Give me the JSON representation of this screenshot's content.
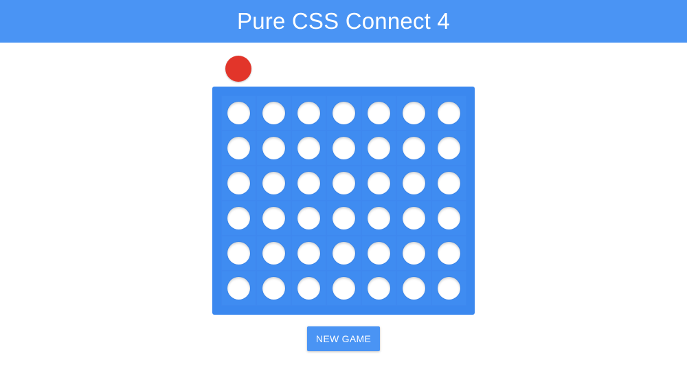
{
  "header": {
    "title": "Pure CSS Connect 4",
    "color": "#4a94f4"
  },
  "current_player": {
    "piece_color": "#e2352a",
    "piece": "red"
  },
  "board": {
    "rows": 6,
    "columns": 7,
    "board_color": "#3b88ef",
    "empty_color": "#ffffff",
    "cells": [
      [
        "empty",
        "empty",
        "empty",
        "empty",
        "empty",
        "empty",
        "empty"
      ],
      [
        "empty",
        "empty",
        "empty",
        "empty",
        "empty",
        "empty",
        "empty"
      ],
      [
        "empty",
        "empty",
        "empty",
        "empty",
        "empty",
        "empty",
        "empty"
      ],
      [
        "empty",
        "empty",
        "empty",
        "empty",
        "empty",
        "empty",
        "empty"
      ],
      [
        "empty",
        "empty",
        "empty",
        "empty",
        "empty",
        "empty",
        "empty"
      ],
      [
        "empty",
        "empty",
        "empty",
        "empty",
        "empty",
        "empty",
        "empty"
      ]
    ]
  },
  "controls": {
    "new_game_label": "NEW GAME"
  }
}
